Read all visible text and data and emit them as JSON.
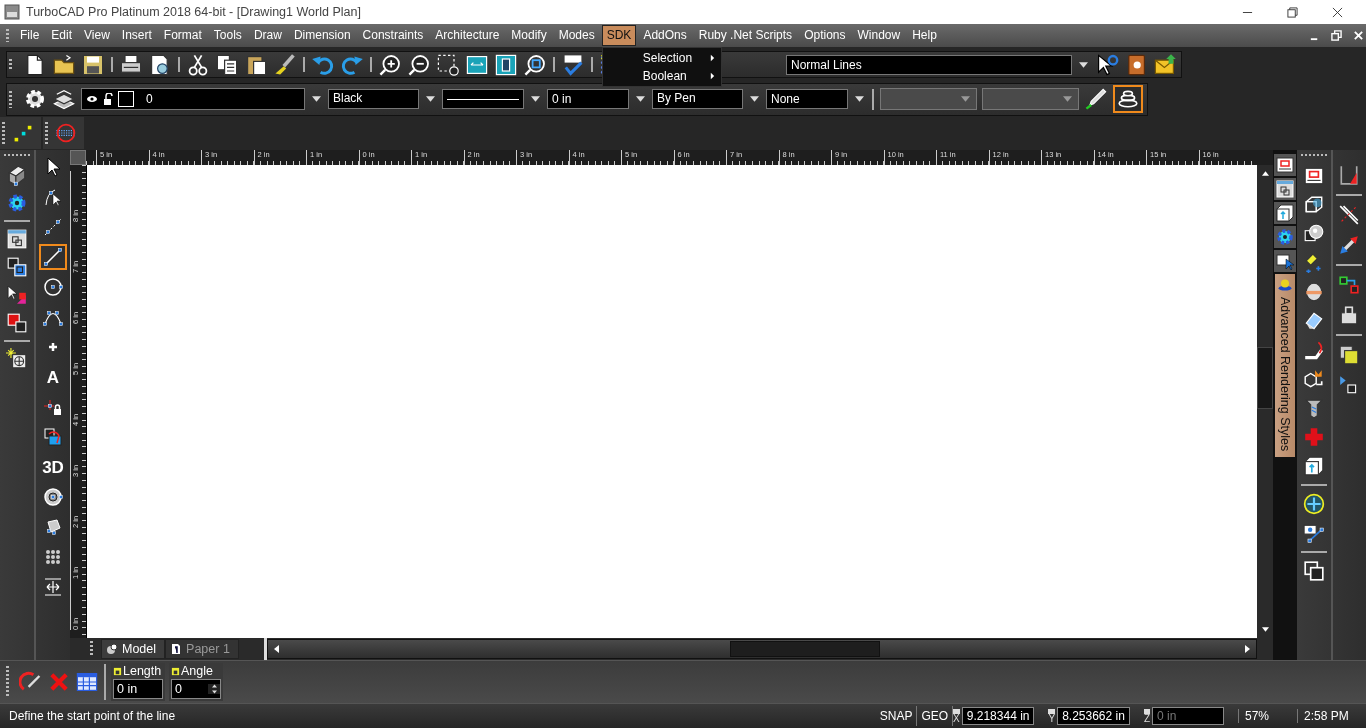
{
  "window": {
    "title": "TurboCAD Pro Platinum 2018 64-bit - [Drawing1 World Plan]"
  },
  "menu": [
    {
      "label": "File",
      "selected": false
    },
    {
      "label": "Edit",
      "selected": false
    },
    {
      "label": "View",
      "selected": false
    },
    {
      "label": "Insert",
      "selected": false
    },
    {
      "label": "Format",
      "selected": false
    },
    {
      "label": "Tools",
      "selected": false
    },
    {
      "label": "Draw",
      "selected": false
    },
    {
      "label": "Dimension",
      "selected": false
    },
    {
      "label": "Constraints",
      "selected": false
    },
    {
      "label": "Architecture",
      "selected": false
    },
    {
      "label": "Modify",
      "selected": false
    },
    {
      "label": "Modes",
      "selected": false
    },
    {
      "label": "SDK",
      "selected": true
    },
    {
      "label": "AddOns",
      "selected": false
    },
    {
      "label": "Ruby .Net Scripts",
      "selected": false
    },
    {
      "label": "Options",
      "selected": false
    },
    {
      "label": "Window",
      "selected": false
    },
    {
      "label": "Help",
      "selected": false
    }
  ],
  "open_menu": {
    "items": [
      {
        "label": "Selection"
      },
      {
        "label": "Boolean"
      }
    ]
  },
  "toolbar": {
    "style_combo": "Normal Lines"
  },
  "properties_bar": {
    "layer": "0",
    "ink": "Black",
    "width": "0 in",
    "pen": "By Pen",
    "fill": "None",
    "render_button": {
      "selected": true
    },
    "extra_combos": [
      {
        "disabled": true
      },
      {
        "disabled": true
      }
    ]
  },
  "draw_tools": [
    {
      "selected": false
    },
    {
      "selected": false
    },
    {
      "selected": false
    },
    {
      "selected": true
    },
    {
      "selected": false
    },
    {
      "selected": false
    },
    {
      "selected": false
    },
    {
      "glyph": "A",
      "selected": false
    },
    {
      "selected": false
    },
    {
      "selected": false
    },
    {
      "glyph": "3D",
      "selected": false
    },
    {
      "selected": false
    },
    {
      "selected": false
    },
    {
      "selected": false
    },
    {
      "selected": false
    }
  ],
  "rulers": {
    "horizontal": [
      "5 in",
      "4 in",
      "3 in",
      "2 in",
      "1 in",
      "0 in",
      "1 in",
      "2 in",
      "3 in",
      "4 in",
      "5 in",
      "6 in",
      "7 in",
      "8 in",
      "9 in",
      "10 in",
      "11 in",
      "12 in",
      "13 in",
      "14 in",
      "15 in",
      "16 in"
    ],
    "vertical": [
      "8 in",
      "7 in",
      "6 in",
      "5 in",
      "4 in",
      "3 in",
      "2 in",
      "1 in",
      "0 in"
    ]
  },
  "side_tabs": [
    {
      "label": "Advanced Rendering Styles",
      "selected": true
    }
  ],
  "sheet_tabs": [
    {
      "label": "Model",
      "selected": true
    },
    {
      "label": "Paper 1",
      "selected": false
    }
  ],
  "inspector": {
    "fields": [
      {
        "kind": "text",
        "label": "Length",
        "value": "0 in"
      },
      {
        "kind": "spin",
        "label": "Angle",
        "value": "0"
      }
    ]
  },
  "status_bar": {
    "message": "Define the start point of the line",
    "indicators": [
      "SNAP",
      "GEO"
    ],
    "coords": [
      {
        "axis": "X",
        "value": "9.218344 in",
        "disabled": false
      },
      {
        "axis": "Y",
        "value": "8.253662 in",
        "disabled": false
      },
      {
        "axis": "Z",
        "value": "0 in",
        "disabled": true
      }
    ],
    "zoom": "57%",
    "time": "2:58 PM"
  }
}
